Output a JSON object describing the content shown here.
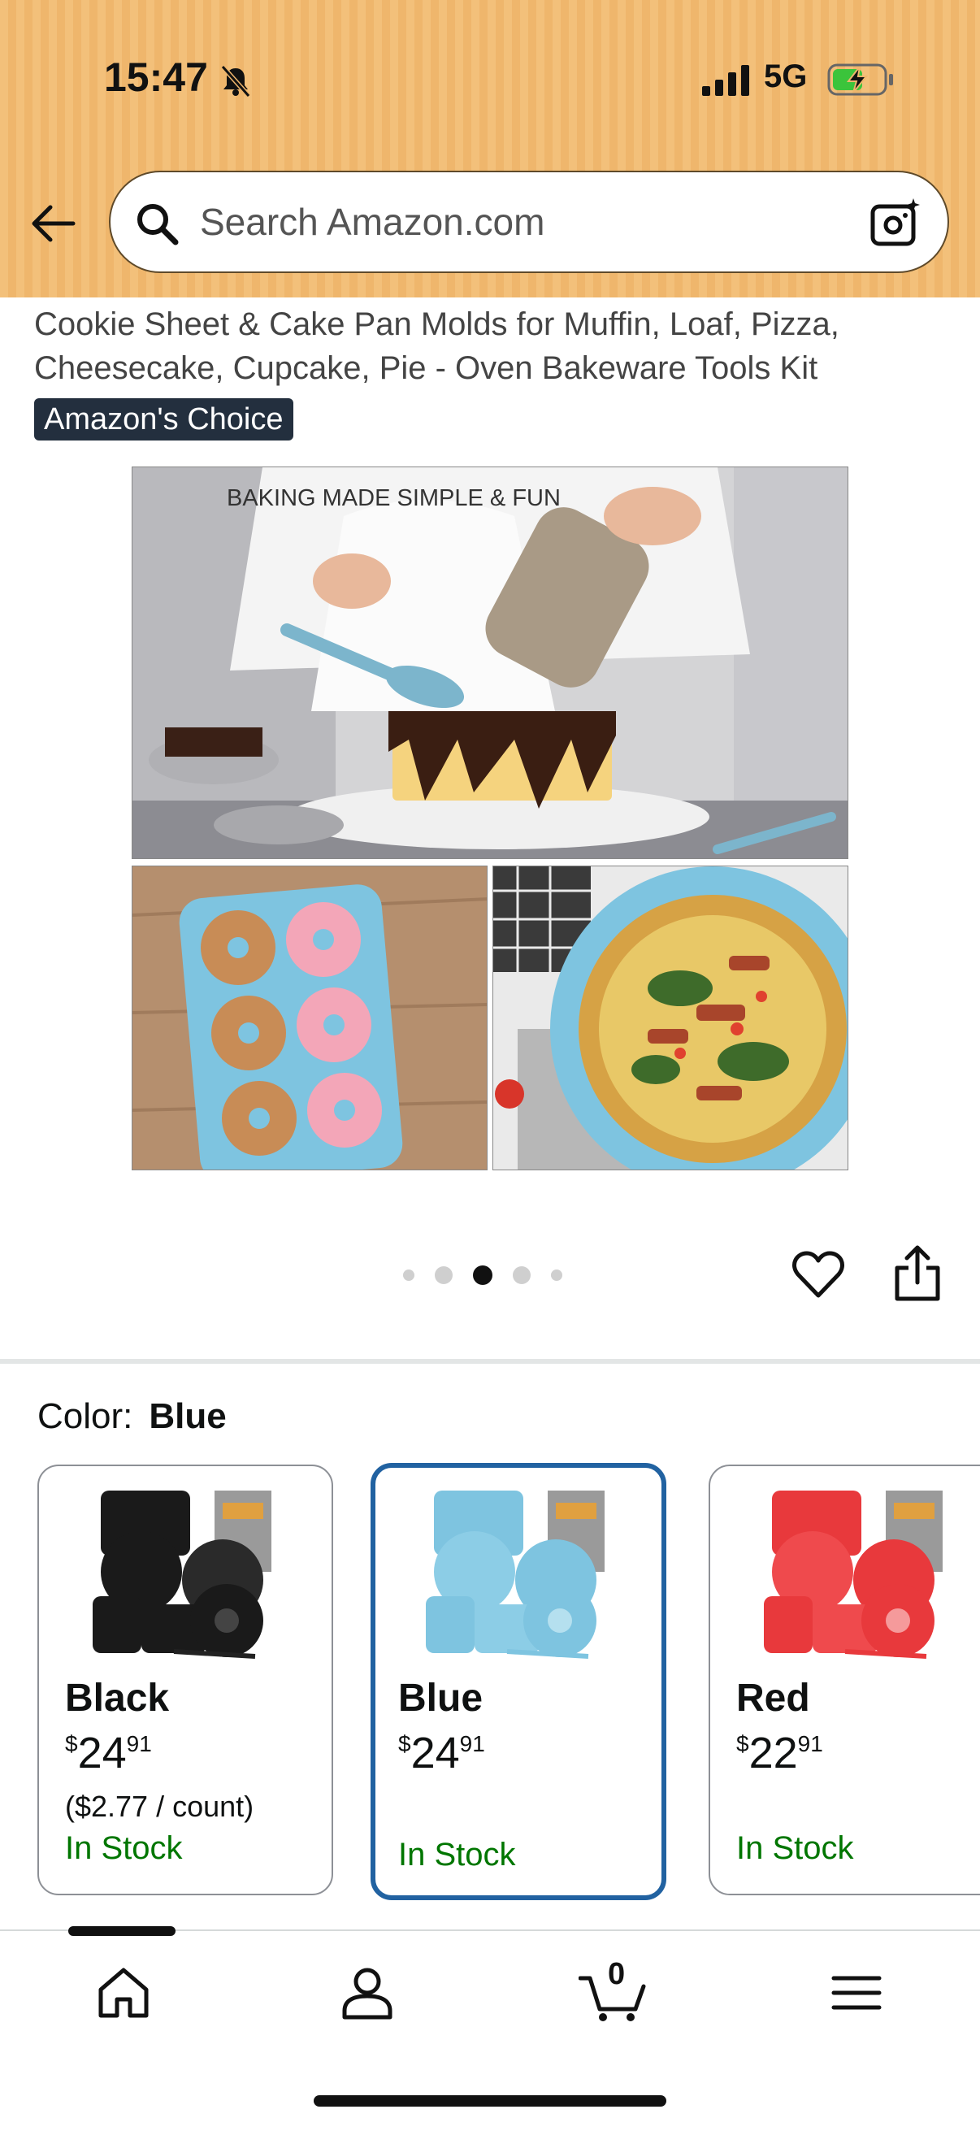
{
  "status_bar": {
    "time": "15:47",
    "network": "5G"
  },
  "search": {
    "placeholder": "Search Amazon.com"
  },
  "product": {
    "title": "Cookie Sheet & Cake Pan Molds for Muffin, Loaf, Pizza, Cheesecake, Cupcake, Pie - Oven Bakeware Tools Kit",
    "badge": "Amazon's Choice",
    "image_caption": "BAKING MADE SIMPLE & FUN",
    "image_dots": {
      "count": 5,
      "active_index": 2
    }
  },
  "color_selector": {
    "label": "Color:",
    "selected": "Blue",
    "options": [
      {
        "name": "Black",
        "currency": "$",
        "dollars": "24",
        "cents": "91",
        "unit_price": "($2.77 / count)",
        "stock": "In Stock",
        "color": "#1a1a1a"
      },
      {
        "name": "Blue",
        "currency": "$",
        "dollars": "24",
        "cents": "91",
        "unit_price": "",
        "stock": "In Stock",
        "color": "#7ec4e0"
      },
      {
        "name": "Red",
        "currency": "$",
        "dollars": "22",
        "cents": "91",
        "unit_price": "",
        "stock": "In Stock",
        "color": "#e8393c"
      }
    ]
  },
  "bottom_nav": {
    "items": [
      "home-icon",
      "account-icon",
      "cart-icon",
      "menu-icon"
    ],
    "cart_count": "0"
  },
  "colors": {
    "header_bg": "#f3c07a",
    "selected_border": "#2162a1",
    "in_stock": "#007600",
    "badge_bg": "#232f3e"
  }
}
